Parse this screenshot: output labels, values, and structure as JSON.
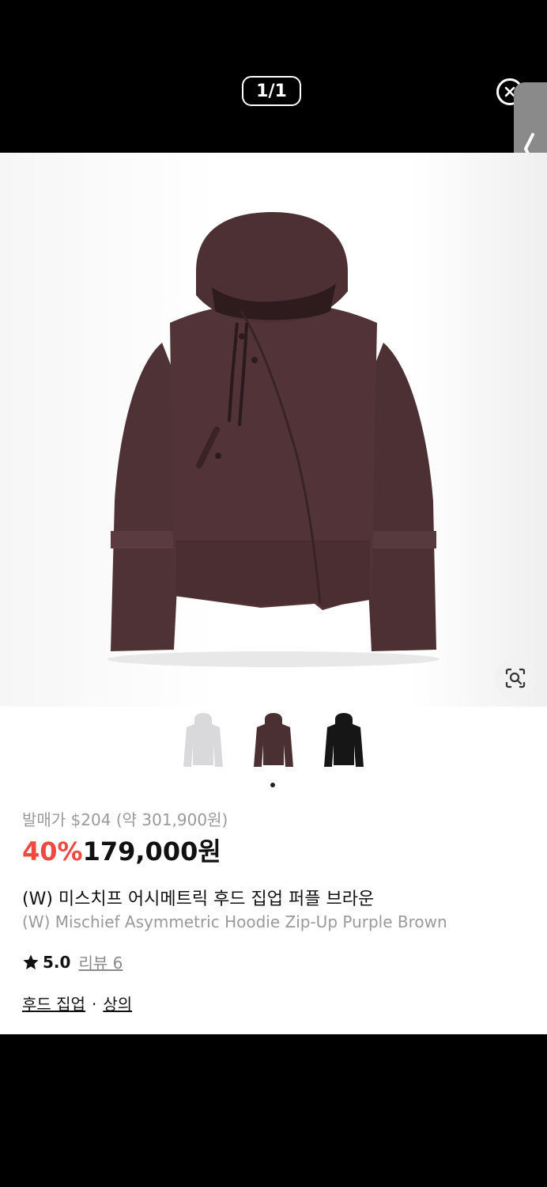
{
  "viewer": {
    "counter": "1/1"
  },
  "product": {
    "original_price": "발매가 $204 (약 301,900원)",
    "discount": "40%",
    "price": "179,000원",
    "name_ko": "(W) 미스치프 어시메트릭 후드 집업 퍼플 브라운",
    "name_en": "(W) Mischief Asymmetric Hoodie Zip-Up Purple Brown",
    "rating": "5.0",
    "review_label": "리뷰 6",
    "categories": [
      "후드 집업",
      "상의"
    ],
    "category_separator": "·"
  },
  "thumbnails": [
    {
      "color": "#d9d9dc",
      "label": "white"
    },
    {
      "color": "#4a3032",
      "label": "purple brown"
    },
    {
      "color": "#161616",
      "label": "black"
    }
  ],
  "colors": {
    "discount": "#ef4a3f",
    "hoodie": "#4f3236"
  },
  "icons": [
    "close-icon",
    "chevron-left-icon",
    "lens-search-icon",
    "star-icon"
  ]
}
